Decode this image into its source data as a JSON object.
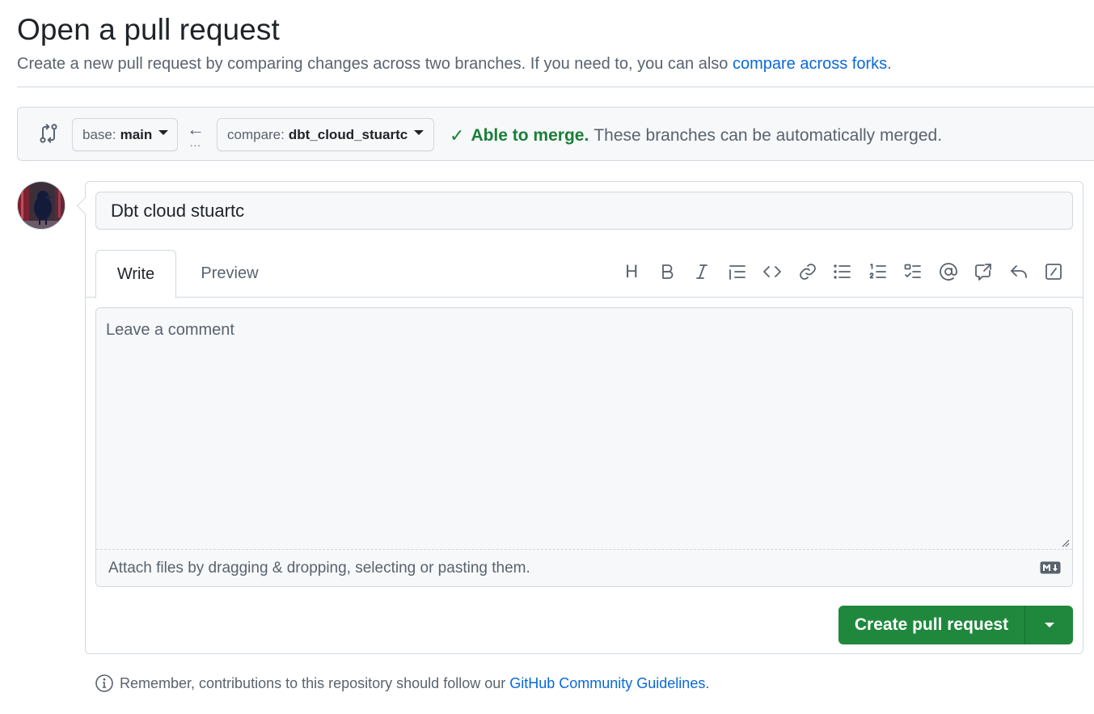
{
  "page": {
    "title": "Open a pull request",
    "subhead_text": "Create a new pull request by comparing changes across two branches. If you need to, you can also",
    "subhead_link": "compare across forks",
    "subhead_end": "."
  },
  "range": {
    "base_prefix": "base:",
    "base_branch": "main",
    "compare_prefix": "compare:",
    "compare_branch": "dbt_cloud_stuartc",
    "dots": "...",
    "merge_ok": "Able to merge.",
    "merge_msg": "These branches can be automatically merged."
  },
  "form": {
    "title_value": "Dbt cloud stuartc",
    "tab_write": "Write",
    "tab_preview": "Preview",
    "toolbar_heading": "H",
    "comment_placeholder": "Leave a comment",
    "attach_text": "Attach files by dragging & dropping, selecting or pasting them.",
    "submit_label": "Create pull request"
  },
  "footer": {
    "text": "Remember, contributions to this repository should follow our",
    "link": "GitHub Community Guidelines",
    "end": "."
  },
  "colors": {
    "accent_blue": "#0969da",
    "success_green": "#1a7f37",
    "button_green": "#1f883d",
    "muted_text": "#59636e",
    "border": "#d1d9e0"
  },
  "icons": [
    "git-compare-icon",
    "caret-down-icon",
    "arrow-left-icon",
    "check-icon",
    "heading-icon",
    "bold-icon",
    "italic-icon",
    "quote-icon",
    "code-icon",
    "link-icon",
    "unordered-list-icon",
    "ordered-list-icon",
    "task-list-icon",
    "mention-icon",
    "cross-reference-icon",
    "reply-icon",
    "slash-command-icon",
    "markdown-icon",
    "info-icon"
  ]
}
